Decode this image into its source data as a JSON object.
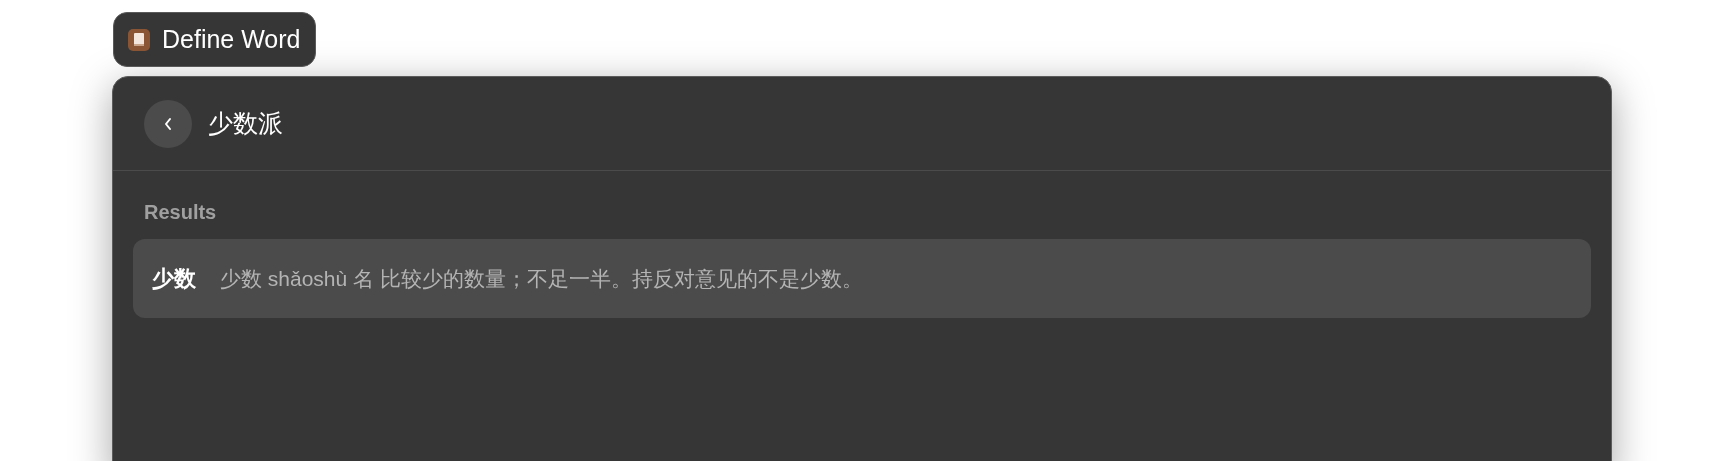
{
  "command_badge": {
    "label": "Define Word"
  },
  "header": {
    "title": "少数派"
  },
  "section": {
    "title": "Results"
  },
  "results": [
    {
      "term": "少数",
      "definition": "少数 shǎoshù 名 比较少的数量；不足一半。持反对意见的不是少数。",
      "selected": true
    }
  ]
}
